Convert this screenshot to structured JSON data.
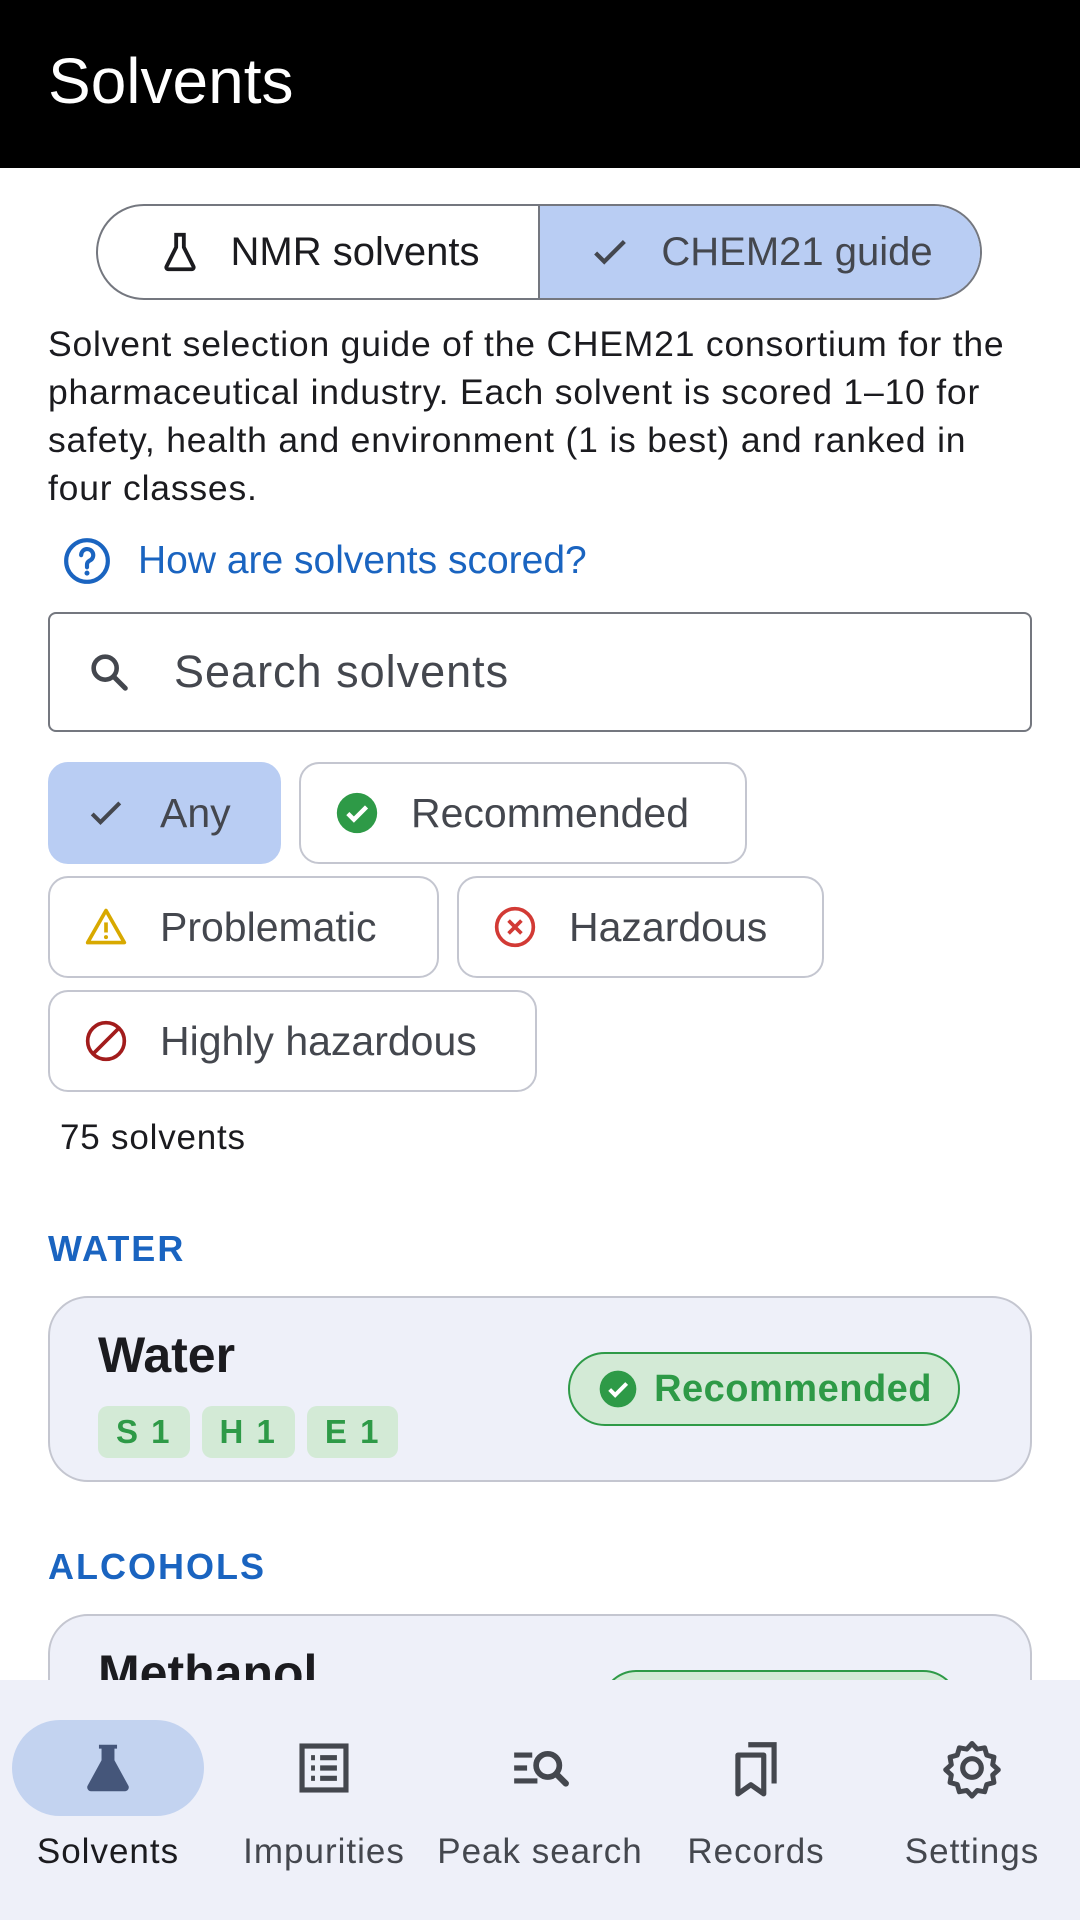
{
  "app_bar": {
    "title": "Solvents"
  },
  "segments": [
    {
      "label": "NMR solvents",
      "icon": "flask-icon",
      "selected": false
    },
    {
      "label": "CHEM21 guide",
      "icon": "check-icon",
      "selected": true
    }
  ],
  "description": "Solvent selection guide of the CHEM21 consortium for the pharmaceutical industry. Each solvent is scored 1–10 for safety, health and environment (1 is best) and ranked in four classes.",
  "help_link": {
    "label": "How are solvents scored?",
    "icon": "help-circle-icon"
  },
  "search": {
    "placeholder": "Search solvents",
    "value": ""
  },
  "filters": [
    {
      "label": "Any",
      "icon": "check-icon",
      "selected": true
    },
    {
      "label": "Recommended",
      "icon": "check-circle-icon",
      "color": "#2e9a47"
    },
    {
      "label": "Problematic",
      "icon": "warning-icon",
      "color": "#d8a900"
    },
    {
      "label": "Hazardous",
      "icon": "cancel-circle-icon",
      "color": "#d23a35"
    },
    {
      "label": "Highly hazardous",
      "icon": "block-icon",
      "color": "#a21c1c"
    }
  ],
  "count_text": "75 solvents",
  "sections": [
    {
      "heading": "WATER",
      "items": [
        {
          "name": "Water",
          "scores": [
            "S 1",
            "H 1",
            "E 1"
          ],
          "badge": "Recommended"
        }
      ]
    },
    {
      "heading": "ALCOHOLS",
      "items": [
        {
          "name": "Methanol"
        }
      ]
    }
  ],
  "nav": [
    {
      "label": "Solvents",
      "icon": "flask-icon",
      "active": true
    },
    {
      "label": "Impurities",
      "icon": "list-icon",
      "active": false
    },
    {
      "label": "Peak search",
      "icon": "peak-search-icon",
      "active": false
    },
    {
      "label": "Records",
      "icon": "bookmarks-icon",
      "active": false
    },
    {
      "label": "Settings",
      "icon": "gear-icon",
      "active": false
    }
  ],
  "colors": {
    "app_bar": "#000000",
    "accent": "#1a64c0",
    "selected_fill": "#b9cdf3",
    "recommended": "#2e9a47",
    "recommended_bg": "#d3ead6",
    "card_bg": "#eef0f9"
  }
}
